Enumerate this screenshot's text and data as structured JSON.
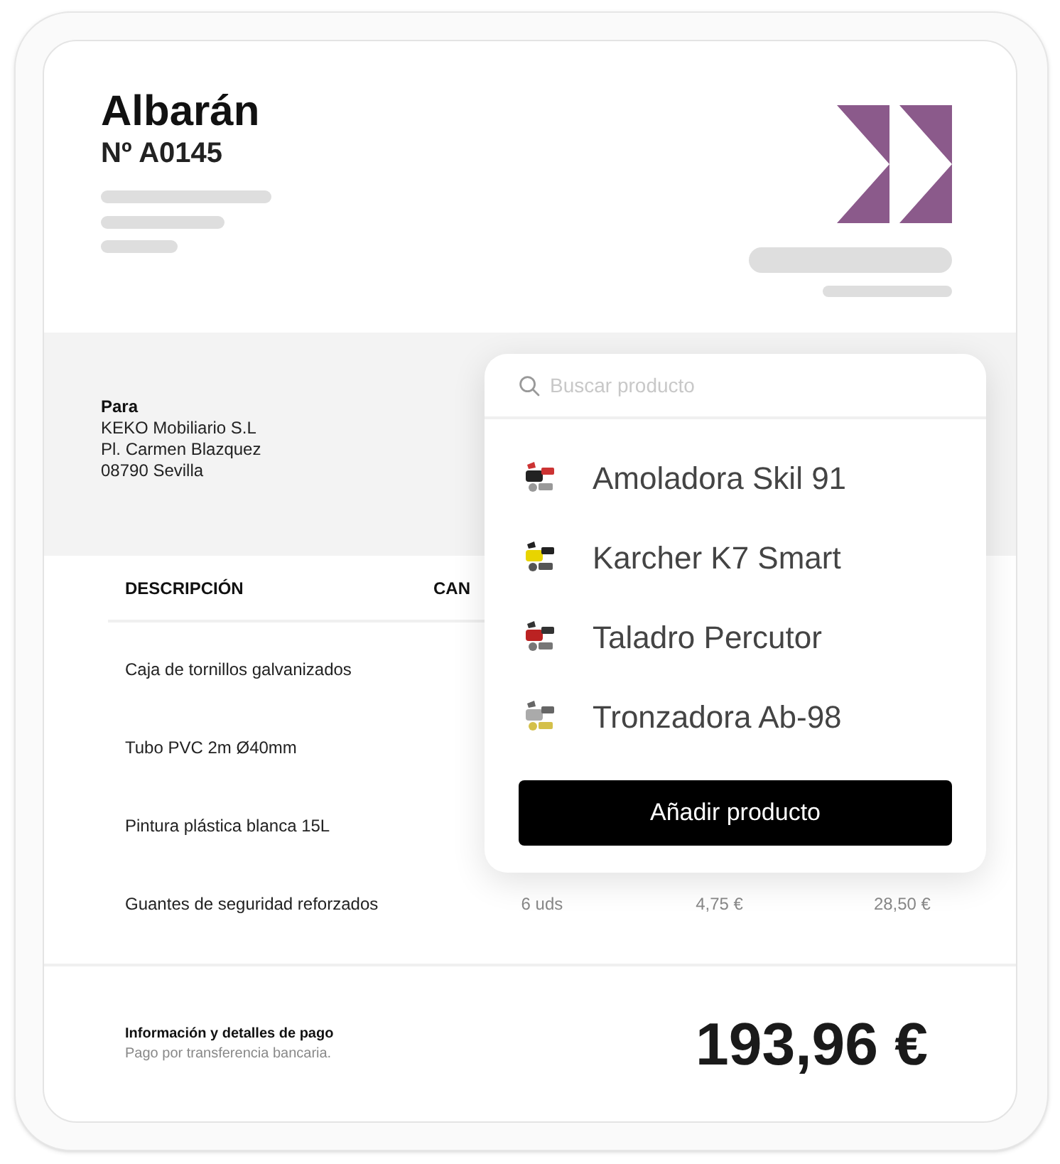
{
  "document": {
    "title": "Albarán",
    "number": "Nº A0145"
  },
  "recipient": {
    "label": "Para",
    "lines": [
      "KEKO Mobiliario S.L",
      "Pl. Carmen Blazquez",
      "08790 Sevilla"
    ]
  },
  "table": {
    "columns": [
      "DESCRIPCIÓN",
      "CAN"
    ],
    "rows": [
      [
        "Caja de tornillos galvanizados"
      ],
      [
        "Tubo PVC 2m Ø40mm"
      ],
      [
        "Pintura plástica blanca 15L"
      ],
      [
        "Guantes de seguridad reforzados",
        "6 uds",
        "4,75 €",
        "28,50 €"
      ]
    ]
  },
  "footer": {
    "title": "Información y detalles de pago",
    "subtitle": "Pago por transferencia bancaria.",
    "total": "193,96 €"
  },
  "product_picker": {
    "search": {
      "placeholder": "Buscar producto"
    },
    "products": [
      {
        "kind": "picture",
        "name": "Amoladora Skil 91"
      },
      {
        "kind": "picture",
        "name": "Karcher K7 Smart"
      },
      {
        "kind": "picture",
        "name": "Taladro Percutor"
      },
      {
        "kind": "picture",
        "name": "Tronzadora Ab-98"
      }
    ],
    "button": "Añadir producto"
  }
}
